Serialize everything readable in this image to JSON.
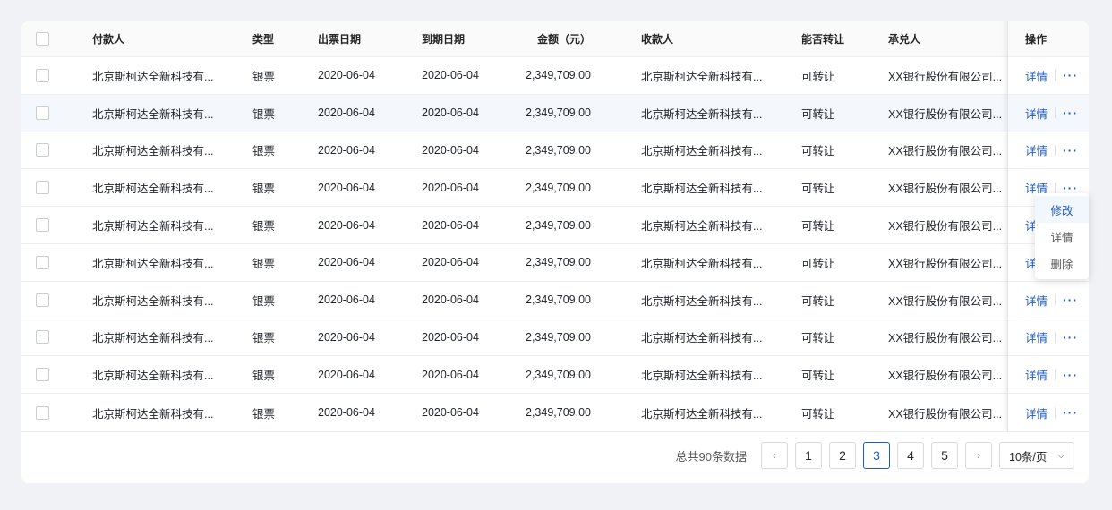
{
  "table": {
    "headers": {
      "payer": "付款人",
      "type": "类型",
      "issue_date": "出票日期",
      "due_date": "到期日期",
      "amount": "金额（元）",
      "payee": "收款人",
      "transferable": "能否转让",
      "acceptor": "承兑人",
      "ops": "操作"
    },
    "rows": [
      {
        "payer": "北京斯柯达全新科技有...",
        "type": "银票",
        "issue_date": "2020-06-04",
        "due_date": "2020-06-04",
        "amount": "2,349,709.00",
        "payee": "北京斯柯达全新科技有...",
        "transferable": "可转让",
        "acceptor": "XX银行股份有限公司...",
        "detail": "详情",
        "more": "···"
      },
      {
        "payer": "北京斯柯达全新科技有...",
        "type": "银票",
        "issue_date": "2020-06-04",
        "due_date": "2020-06-04",
        "amount": "2,349,709.00",
        "payee": "北京斯柯达全新科技有...",
        "transferable": "可转让",
        "acceptor": "XX银行股份有限公司...",
        "detail": "详情",
        "more": "···"
      },
      {
        "payer": "北京斯柯达全新科技有...",
        "type": "银票",
        "issue_date": "2020-06-04",
        "due_date": "2020-06-04",
        "amount": "2,349,709.00",
        "payee": "北京斯柯达全新科技有...",
        "transferable": "可转让",
        "acceptor": "XX银行股份有限公司...",
        "detail": "详情",
        "more": "···"
      },
      {
        "payer": "北京斯柯达全新科技有...",
        "type": "银票",
        "issue_date": "2020-06-04",
        "due_date": "2020-06-04",
        "amount": "2,349,709.00",
        "payee": "北京斯柯达全新科技有...",
        "transferable": "可转让",
        "acceptor": "XX银行股份有限公司...",
        "detail": "详情",
        "more": "···"
      },
      {
        "payer": "北京斯柯达全新科技有...",
        "type": "银票",
        "issue_date": "2020-06-04",
        "due_date": "2020-06-04",
        "amount": "2,349,709.00",
        "payee": "北京斯柯达全新科技有...",
        "transferable": "可转让",
        "acceptor": "XX银行股份有限公司...",
        "detail": "详",
        "more": ""
      },
      {
        "payer": "北京斯柯达全新科技有...",
        "type": "银票",
        "issue_date": "2020-06-04",
        "due_date": "2020-06-04",
        "amount": "2,349,709.00",
        "payee": "北京斯柯达全新科技有...",
        "transferable": "可转让",
        "acceptor": "XX银行股份有限公司...",
        "detail": "详",
        "more": ""
      },
      {
        "payer": "北京斯柯达全新科技有...",
        "type": "银票",
        "issue_date": "2020-06-04",
        "due_date": "2020-06-04",
        "amount": "2,349,709.00",
        "payee": "北京斯柯达全新科技有...",
        "transferable": "可转让",
        "acceptor": "XX银行股份有限公司...",
        "detail": "详情",
        "more": "···"
      },
      {
        "payer": "北京斯柯达全新科技有...",
        "type": "银票",
        "issue_date": "2020-06-04",
        "due_date": "2020-06-04",
        "amount": "2,349,709.00",
        "payee": "北京斯柯达全新科技有...",
        "transferable": "可转让",
        "acceptor": "XX银行股份有限公司...",
        "detail": "详情",
        "more": "···"
      },
      {
        "payer": "北京斯柯达全新科技有...",
        "type": "银票",
        "issue_date": "2020-06-04",
        "due_date": "2020-06-04",
        "amount": "2,349,709.00",
        "payee": "北京斯柯达全新科技有...",
        "transferable": "可转让",
        "acceptor": "XX银行股份有限公司...",
        "detail": "详情",
        "more": "···"
      },
      {
        "payer": "北京斯柯达全新科技有...",
        "type": "银票",
        "issue_date": "2020-06-04",
        "due_date": "2020-06-04",
        "amount": "2,349,709.00",
        "payee": "北京斯柯达全新科技有...",
        "transferable": "可转让",
        "acceptor": "XX银行股份有限公司...",
        "detail": "详情",
        "more": "···"
      }
    ],
    "highlighted_row": 1
  },
  "dropdown": {
    "items": [
      "修改",
      "详情",
      "删除"
    ],
    "active_index": 0
  },
  "pagination": {
    "total_text": "总共90条数据",
    "prev_icon": "chevron-left-icon",
    "next_icon": "chevron-right-icon",
    "prev_glyph": "‹",
    "next_glyph": "›",
    "pages": [
      "1",
      "2",
      "3",
      "4",
      "5"
    ],
    "current_page": "3",
    "page_size": "10条/页",
    "page_size_glyph": "⌵"
  },
  "colors": {
    "accent": "#1f5cc7",
    "background": "#f0f2f5",
    "row_highlight": "#f4f7fc"
  }
}
